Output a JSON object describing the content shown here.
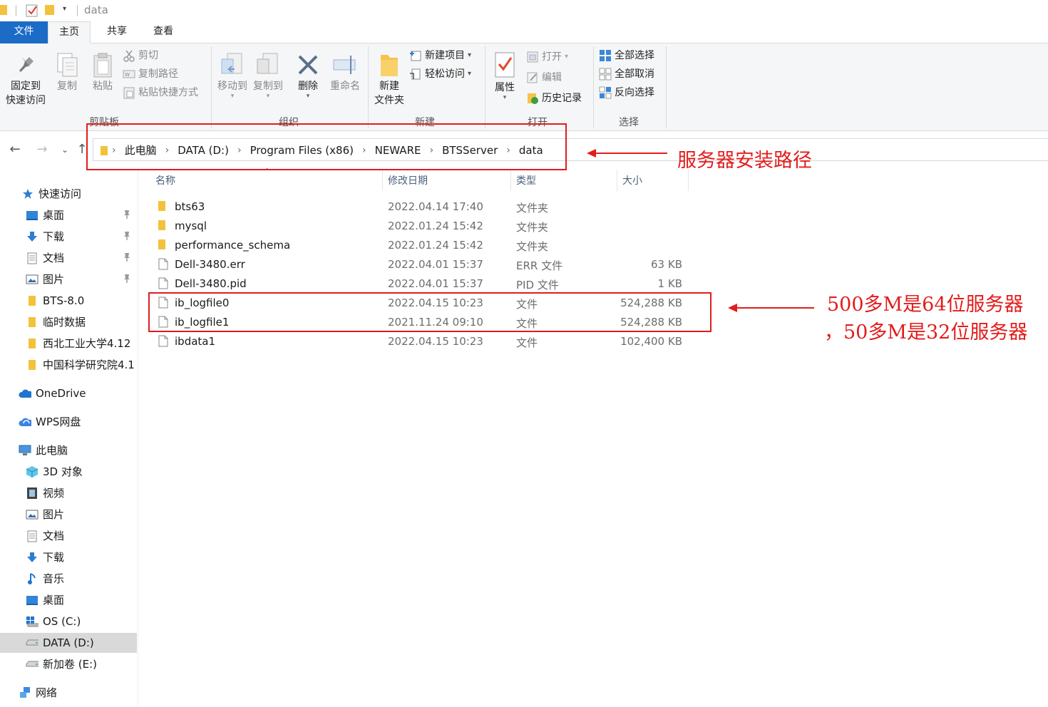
{
  "window": {
    "title": "data"
  },
  "ribbon_tabs": {
    "file": "文件",
    "home": "主页",
    "share": "共享",
    "view": "查看"
  },
  "ribbon": {
    "clipboard": {
      "label": "剪贴板",
      "pin": "固定到\n快速访问",
      "pin_l1": "固定到",
      "pin_l2": "快速访问",
      "copy": "复制",
      "paste": "粘贴",
      "cut": "剪切",
      "copy_path": "复制路径",
      "paste_shortcut": "粘贴快捷方式"
    },
    "organize": {
      "label": "组织",
      "move_to": "移动到",
      "copy_to": "复制到",
      "delete": "删除",
      "rename": "重命名"
    },
    "new": {
      "label": "新建",
      "new_folder_l1": "新建",
      "new_folder_l2": "文件夹",
      "new_item": "新建项目",
      "easy_access": "轻松访问"
    },
    "open": {
      "label": "打开",
      "properties": "属性",
      "open": "打开",
      "edit": "编辑",
      "history": "历史记录"
    },
    "select": {
      "label": "选择",
      "select_all": "全部选择",
      "select_none": "全部取消",
      "invert": "反向选择"
    }
  },
  "address": {
    "crumbs": [
      "此电脑",
      "DATA (D:)",
      "Program Files (x86)",
      "NEWARE",
      "BTSServer",
      "data"
    ]
  },
  "sidebar": {
    "items": [
      {
        "label": "快速访问",
        "icon": "star-icon"
      },
      {
        "label": "桌面",
        "icon": "desktop-icon",
        "pinned": true
      },
      {
        "label": "下载",
        "icon": "download-icon",
        "pinned": true
      },
      {
        "label": "文档",
        "icon": "document-icon",
        "pinned": true
      },
      {
        "label": "图片",
        "icon": "pictures-icon",
        "pinned": true
      },
      {
        "label": "BTS-8.0",
        "icon": "folder-icon"
      },
      {
        "label": "临时数据",
        "icon": "folder-icon"
      },
      {
        "label": "西北工业大学4.12",
        "icon": "folder-icon"
      },
      {
        "label": "中国科学研究院4.1",
        "icon": "folder-icon"
      },
      {
        "label": "OneDrive",
        "icon": "onedrive-icon"
      },
      {
        "label": "WPS网盘",
        "icon": "wps-cloud-icon"
      },
      {
        "label": "此电脑",
        "icon": "computer-icon"
      },
      {
        "label": "3D 对象",
        "icon": "3d-objects-icon"
      },
      {
        "label": "视频",
        "icon": "video-icon"
      },
      {
        "label": "图片",
        "icon": "pictures-icon"
      },
      {
        "label": "文档",
        "icon": "document-icon"
      },
      {
        "label": "下载",
        "icon": "download-icon"
      },
      {
        "label": "音乐",
        "icon": "music-icon"
      },
      {
        "label": "桌面",
        "icon": "desktop-icon"
      },
      {
        "label": "OS (C:)",
        "icon": "os-drive-icon"
      },
      {
        "label": "DATA (D:)",
        "icon": "drive-icon",
        "selected": true
      },
      {
        "label": "新加卷 (E:)",
        "icon": "drive-icon"
      },
      {
        "label": "网络",
        "icon": "network-icon"
      }
    ]
  },
  "columns": {
    "name": "名称",
    "modified": "修改日期",
    "type": "类型",
    "size": "大小"
  },
  "files": [
    {
      "name": "bts63",
      "modified": "2022.04.14 17:40",
      "type": "文件夹",
      "size": "",
      "icon": "folder-icon"
    },
    {
      "name": "mysql",
      "modified": "2022.01.24 15:42",
      "type": "文件夹",
      "size": "",
      "icon": "folder-icon"
    },
    {
      "name": "performance_schema",
      "modified": "2022.01.24 15:42",
      "type": "文件夹",
      "size": "",
      "icon": "folder-icon"
    },
    {
      "name": "Dell-3480.err",
      "modified": "2022.04.01 15:37",
      "type": "ERR 文件",
      "size": "63 KB",
      "icon": "file-icon"
    },
    {
      "name": "Dell-3480.pid",
      "modified": "2022.04.01 15:37",
      "type": "PID 文件",
      "size": "1 KB",
      "icon": "file-icon"
    },
    {
      "name": "ib_logfile0",
      "modified": "2022.04.15 10:23",
      "type": "文件",
      "size": "524,288 KB",
      "icon": "file-icon"
    },
    {
      "name": "ib_logfile1",
      "modified": "2021.11.24 09:10",
      "type": "文件",
      "size": "524,288 KB",
      "icon": "file-icon"
    },
    {
      "name": "ibdata1",
      "modified": "2022.04.15 10:23",
      "type": "文件",
      "size": "102,400 KB",
      "icon": "file-icon"
    }
  ],
  "annotations": {
    "path_note": "服务器安装路径",
    "size_note_line1": "500多M是64位服务器",
    "size_note_line2": "，50多M是32位服务器",
    "color": "#e21c1c"
  }
}
